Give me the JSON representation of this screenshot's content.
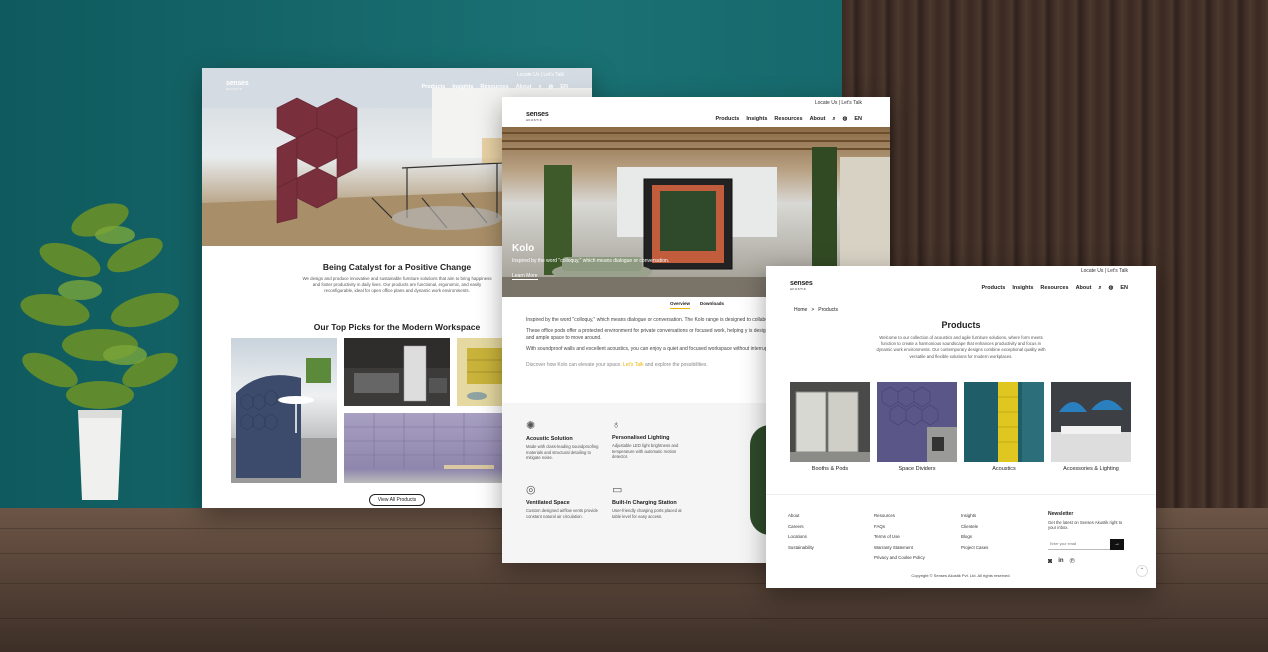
{
  "card1": {
    "logo": "senses",
    "logo_sub": "AKUSTIK",
    "top_links": "Locate Us | Let's Talk",
    "nav": [
      "Products",
      "Insights",
      "Resources",
      "About"
    ],
    "lang": "EN",
    "heading": "Being Catalyst for a Positive Change",
    "body": "We design and produce innovative and sustainable furniture solutions that aim to bring happiness and foster productivity in daily lives. Our products are functional, ergonomic, and easily reconfigurable, ideal for open office plans and dynamic work environments.",
    "picks_heading": "Our Top Picks for the Modern Workspace",
    "view_all": "View All Products"
  },
  "card2": {
    "logo": "senses",
    "logo_sub": "AKUSTIK",
    "top_links": "Locate Us | Let's Talk",
    "nav": [
      "Products",
      "Insights",
      "Resources",
      "About"
    ],
    "lang": "EN",
    "hero_title": "Kolo",
    "hero_sub": "Inspired by the word \"colloquy,\" which means dialogue or conversation.",
    "hero_cta": "Learn More",
    "tabs": [
      "Overview",
      "Downloads"
    ],
    "para1": "Inspired by the word \"colloquy,\" which means dialogue or conversation. The Kolo range is designed to collaboration, discussion, and productivity.",
    "para2": "These office pods offer a protected environment for private conversations or focused work, helping y is designed with comfort in mind, featuring ergonomic seating and ample space to move around.",
    "para3": "With soundproof walls and excellent acoustics, you can enjoy a quiet and focused workspace without interruptions.",
    "discover_pre": "Discover how Kolo can elevate your space.",
    "discover_link": "Let's Talk",
    "discover_post": "and explore the possibilities.",
    "features": [
      {
        "title": "Acoustic Solution",
        "desc": "Made with class-leading soundproofing materials and structural detailing to mitigate noise."
      },
      {
        "title": "Personalised Lighting",
        "desc": "Adjustable LED light brightness and temperature with automatic motion detector."
      },
      {
        "title": "Ventilated Space",
        "desc": "Custom designed airflow vents provide constant natural air circulation."
      },
      {
        "title": "Built-In Charging Station",
        "desc": "User-friendly charging ports placed at table level for easy access."
      }
    ]
  },
  "card3": {
    "logo": "senses",
    "logo_sub": "AKUSTIK",
    "top_links": "Locate Us | Let's Talk",
    "nav": [
      "Products",
      "Insights",
      "Resources",
      "About"
    ],
    "lang": "EN",
    "breadcrumb_home": "Home",
    "breadcrumb_sep": ">",
    "breadcrumb_current": "Products",
    "title": "Products",
    "intro": "Welcome to our collection of acoustics and agile furniture solutions, where form meets function to create a harmonious soundscape that enhances productivity and focus in dynamic work environments. Our contemporary designs combine exceptional quality with versatile and flexible solutions for modern workplaces.",
    "products": [
      "Booths & Pods",
      "Space Dividers",
      "Acoustics",
      "Accessories & Lighting"
    ],
    "footer_col1": [
      "About",
      "Careers",
      "Locations",
      "Sustainability"
    ],
    "footer_col2": [
      "Resources",
      "FAQs",
      "Terms of Use",
      "Warranty Statement",
      "Privacy and Cookie Policy"
    ],
    "footer_col3": [
      "Insights",
      "Clientele",
      "Blogs",
      "Project Cases"
    ],
    "newsletter_title": "Newsletter",
    "newsletter_text": "Get the latest on Senses Akustik right to your inbox.",
    "email_placeholder": "Enter your email",
    "submit_arrow": "→",
    "copyright": "Copyright © Senses Akustik Pvt. Ltd. All rights reserved."
  },
  "icons": [
    "search-icon",
    "globe-icon",
    "instagram-icon",
    "linkedin-icon",
    "pinterest-icon",
    "scroll-top-icon"
  ],
  "colors": {
    "accent": "#e8b400",
    "wall": "#1a7173",
    "felt": "#7a2f3c"
  }
}
